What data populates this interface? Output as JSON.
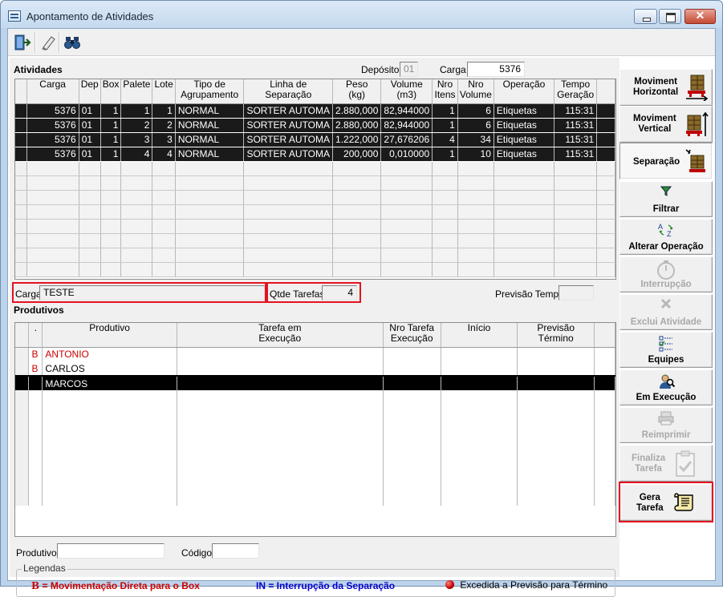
{
  "window": {
    "title": "Apontamento de Atividades"
  },
  "toolbar": {
    "buttons": [
      {
        "name": "exit-icon"
      },
      {
        "name": "eraser-icon"
      },
      {
        "name": "binoculars-icon"
      }
    ]
  },
  "atividades": {
    "section_label": "Atividades",
    "deposito_label": "Depósito",
    "deposito_value": "01",
    "carga_label": "Carga",
    "carga_value": "5376",
    "columns": [
      "Carga",
      "Dep",
      "Box",
      "Palete",
      "Lote",
      "Tipo de\nAgrupamento",
      "Linha de\nSeparação",
      "Peso\n(kg)",
      "Volume\n(m3)",
      "Nro\nItens",
      "Nro\nVolume",
      "Operação",
      "Tempo\nGeração"
    ],
    "rows": [
      [
        "5376",
        "01",
        "1",
        "1",
        "1",
        "NORMAL",
        "SORTER AUTOMA",
        "2.880,000",
        "82,944000",
        "1",
        "6",
        "Etiquetas",
        "115:31"
      ],
      [
        "5376",
        "01",
        "1",
        "2",
        "2",
        "NORMAL",
        "SORTER AUTOMA",
        "2.880,000",
        "82,944000",
        "1",
        "6",
        "Etiquetas",
        "115:31"
      ],
      [
        "5376",
        "01",
        "1",
        "3",
        "3",
        "NORMAL",
        "SORTER AUTOMA",
        "1.222,000",
        "27,676206",
        "4",
        "34",
        "Etiquetas",
        "115:31"
      ],
      [
        "5376",
        "01",
        "1",
        "4",
        "4",
        "NORMAL",
        "SORTER AUTOMA",
        "200,000",
        "0,010000",
        "1",
        "10",
        "Etiquetas",
        "115:31"
      ]
    ]
  },
  "carga_info": {
    "carga_label": "Carga",
    "carga_value": "TESTE",
    "qtde_label": "Qtde Tarefas",
    "qtde_value": "4",
    "previsao_label": "Previsão Tempo",
    "previsao_value": ""
  },
  "produtivos": {
    "section_label": "Produtivos",
    "columns": [
      ".",
      "Produtivo",
      "Tarefa em\nExecução",
      "Nro Tarefa\nExecução",
      "Início",
      "Previsão\nTérmino"
    ],
    "rows": [
      {
        "flag": "B",
        "name": "ANTONIO",
        "flag_red": true,
        "name_red": true,
        "selected": false
      },
      {
        "flag": "B",
        "name": "CARLOS",
        "flag_red": true,
        "name_red": false,
        "selected": false
      },
      {
        "flag": "",
        "name": "MARCOS",
        "flag_red": false,
        "name_red": false,
        "selected": true
      }
    ],
    "produtivo_label": "Produtivo",
    "produtivo_value": "",
    "codigo_label": "Código",
    "codigo_value": ""
  },
  "legendas": {
    "title": "Legendas",
    "item1_symbol": "B",
    "item1_text": "= Movimentação Direta para o Box",
    "item2_symbol": "IN",
    "item2_text": "= Interrupção da Separação",
    "item3_text": "Excedida a Previsão para Término",
    "colors": {
      "red": "#cc0000",
      "blue": "#0000cc"
    }
  },
  "side_buttons": [
    {
      "name": "moviment-horizontal-button",
      "label": "Moviment\nHorizontal",
      "icon": "pallet-horizontal-icon",
      "enabled": true
    },
    {
      "name": "moviment-vertical-button",
      "label": "Moviment\nVertical",
      "icon": "pallet-vertical-icon",
      "enabled": true
    },
    {
      "name": "separacao-button",
      "label": "Separação",
      "icon": "pallet-separation-icon",
      "enabled": true
    },
    {
      "name": "filtrar-button",
      "label": "Filtrar",
      "icon": "filter-icon",
      "enabled": true
    },
    {
      "name": "alterar-operacao-button",
      "label": "Alterar Operação",
      "icon": "sort-az-icon",
      "enabled": true
    },
    {
      "name": "interrupcao-button",
      "label": "Interrupção",
      "icon": "stopwatch-icon",
      "enabled": false
    },
    {
      "name": "exclui-atividade-button",
      "label": "Exclui Atividade",
      "icon": "delete-x-icon",
      "enabled": false
    },
    {
      "name": "equipes-button",
      "label": "Equipes",
      "icon": "checklist-icon",
      "enabled": true
    },
    {
      "name": "em-execucao-button",
      "label": "Em Execução",
      "icon": "person-search-icon",
      "enabled": true
    },
    {
      "name": "reimprimir-button",
      "label": "Reimprimir",
      "icon": "printer-icon",
      "enabled": false
    },
    {
      "name": "finaliza-tarefa-button",
      "label": "Finaliza\nTarefa",
      "icon": "clipboard-check-icon",
      "enabled": false
    },
    {
      "name": "gera-tarefa-button",
      "label": "Gera\nTarefa",
      "icon": "scroll-icon",
      "enabled": true
    }
  ]
}
